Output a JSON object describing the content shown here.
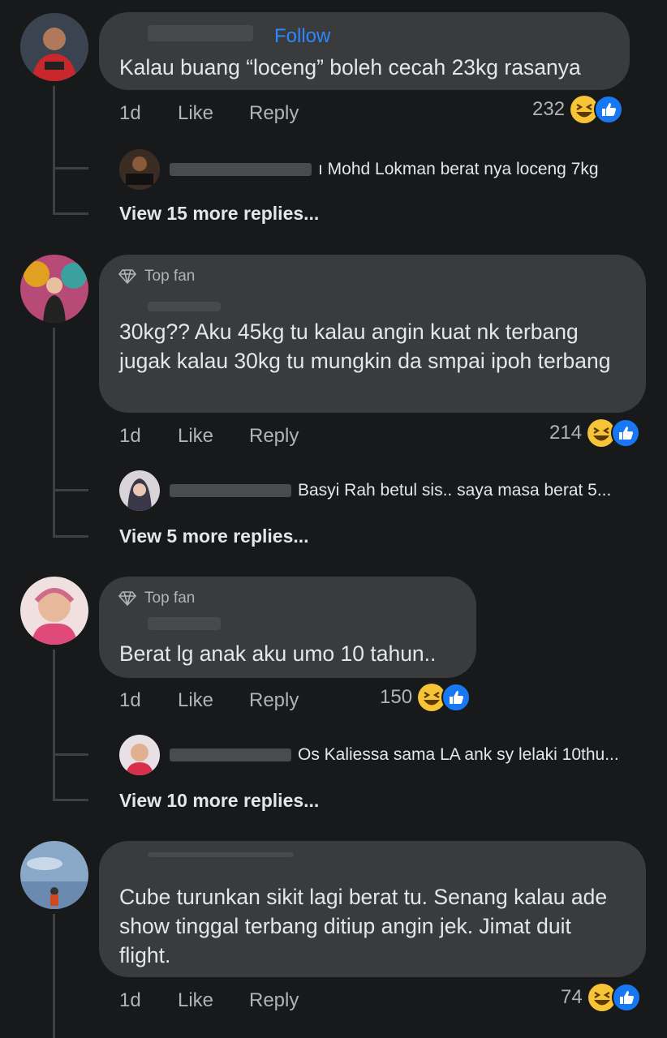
{
  "comments": [
    {
      "follow_label": "Follow",
      "text": "Kalau buang “loceng” boleh cecah 23kg rasanya",
      "time": "1d",
      "like_label": "Like",
      "reply_label": "Reply",
      "reaction_count": "232",
      "reply_preview": {
        "text": "ı Mohd Lokman berat nya loceng 7kg"
      },
      "more_replies": "View 15 more replies..."
    },
    {
      "badge": "Top fan",
      "text": "30kg?? Aku 45kg tu kalau angin kuat nk terbang jugak kalau 30kg tu mungkin da smpai ipoh terbang",
      "time": "1d",
      "like_label": "Like",
      "reply_label": "Reply",
      "reaction_count": "214",
      "reply_preview": {
        "text": "Basyi Rah betul sis.. saya masa berat 5..."
      },
      "more_replies": "View 5 more replies..."
    },
    {
      "badge": "Top fan",
      "text": "Berat lg anak aku umo 10 tahun..",
      "time": "1d",
      "like_label": "Like",
      "reply_label": "Reply",
      "reaction_count": "150",
      "reply_preview": {
        "text": "Os Kaliessa sama LA ank sy lelaki 10thu..."
      },
      "more_replies": "View 10 more replies..."
    },
    {
      "text": "Cube turunkan sikit lagi berat tu. Senang kalau ade show tinggal terbang ditiup angin jek. Jimat duit flight.",
      "time": "1d",
      "like_label": "Like",
      "reply_label": "Reply",
      "reaction_count": "74"
    }
  ],
  "icons": {
    "reaction_laugh": "haha-emoji-icon",
    "reaction_like": "thumbs-up-icon",
    "top_fan": "diamond-icon"
  },
  "colors": {
    "background": "#18191a",
    "bubble": "#3a3b3c",
    "link": "#2d88ff",
    "secondary_text": "#b0b3b8",
    "like_blue": "#1877f2",
    "haha_yellow": "#f7c438"
  }
}
